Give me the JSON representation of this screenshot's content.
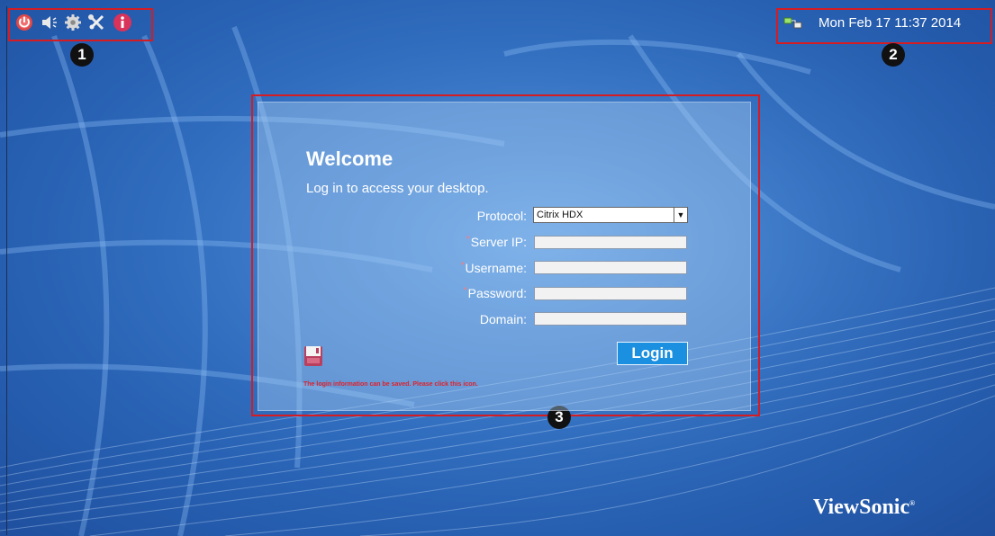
{
  "taskbar": {
    "icons": [
      "power-icon",
      "volume-icon",
      "settings-icon",
      "tools-icon",
      "info-icon"
    ],
    "network_icon": "network-icon",
    "clock": "Mon  Feb 17  11:37  2014"
  },
  "callouts": {
    "one": "1",
    "two": "2",
    "three": "3"
  },
  "login": {
    "title": "Welcome",
    "subtitle": "Log in to access your desktop.",
    "fields": {
      "protocol": {
        "label": "Protocol:",
        "value": "Citrix HDX",
        "required": false
      },
      "server_ip": {
        "label": "Server IP:",
        "value": "",
        "required": true
      },
      "username": {
        "label": "Username:",
        "value": "",
        "required": true
      },
      "password": {
        "label": "Password:",
        "value": "",
        "required": true
      },
      "domain": {
        "label": "Domain:",
        "value": "",
        "required": false
      }
    },
    "required_marker": "*",
    "login_button": "Login",
    "save_icon": "save-disk-icon",
    "save_hint": "The login information can be saved. Please click this icon."
  },
  "brand": {
    "name": "ViewSonic",
    "mark": "®"
  },
  "colors": {
    "callout_red": "#d51c23",
    "hint_red": "#e0202a",
    "button_blue": "#1b8fe0"
  }
}
